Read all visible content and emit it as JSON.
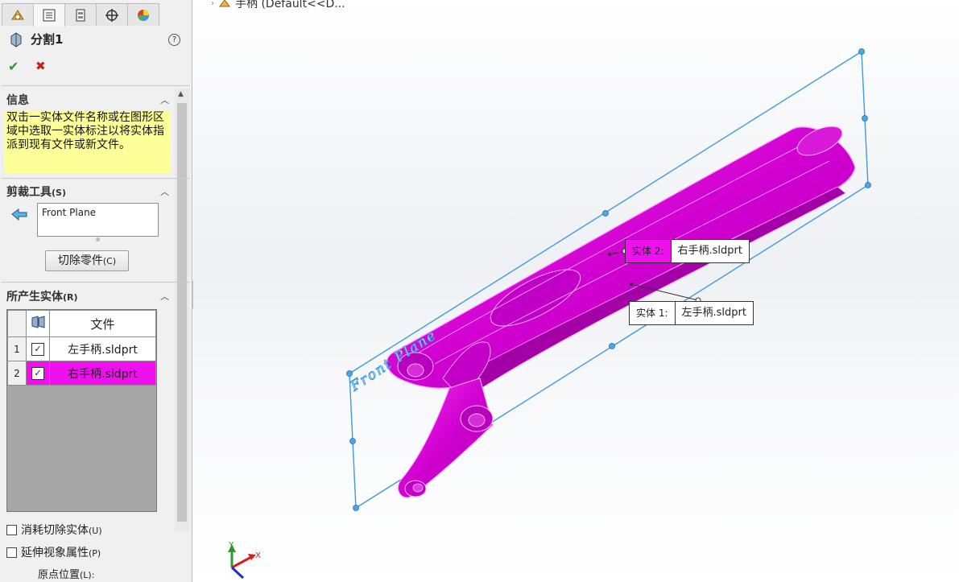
{
  "panel": {
    "tabs": [
      "feature-manager",
      "property-manager",
      "configuration-manager",
      "dimxpert-manager",
      "display-manager"
    ],
    "feature_name": "分割1",
    "help": "?",
    "ok": "✔",
    "cancel": "✖"
  },
  "info": {
    "title": "信息",
    "message": "双击一实体文件名称或在图形区域中选取一实体标注以将实体指派到现有文件或新文件。"
  },
  "trim_tools": {
    "title": "剪裁工具",
    "shortcut": "(S)",
    "selection": "Front Plane",
    "cut_button": "切除零件",
    "cut_shortcut": "(C)"
  },
  "resulting_bodies": {
    "title": "所产生实体",
    "shortcut": "(R)",
    "column_file": "文件",
    "rows": [
      {
        "num": "1",
        "checked": true,
        "file": "左手柄.sldprt",
        "selected": false
      },
      {
        "num": "2",
        "checked": true,
        "file": "右手柄.sldprt",
        "selected": true
      }
    ]
  },
  "options": {
    "consume": "消耗切除实体",
    "consume_shortcut": "(U)",
    "propagate": "延伸视象属性",
    "propagate_shortcut": "(P)",
    "origin": "原点位置",
    "origin_shortcut": "(L):"
  },
  "viewport": {
    "crumb": "手柄  (Default<<D...",
    "plane_label": "Front Plane",
    "callout_body2": {
      "label": "实体   2:",
      "file": "右手柄.sldprt"
    },
    "callout_body1": {
      "label": "实体   1:",
      "file": "左手柄.sldprt"
    },
    "triad": {
      "x": "X",
      "y": "Y"
    }
  },
  "colors": {
    "body": "#ee11ee",
    "plane": "#3d9be0",
    "info_bg": "#ffff99"
  }
}
